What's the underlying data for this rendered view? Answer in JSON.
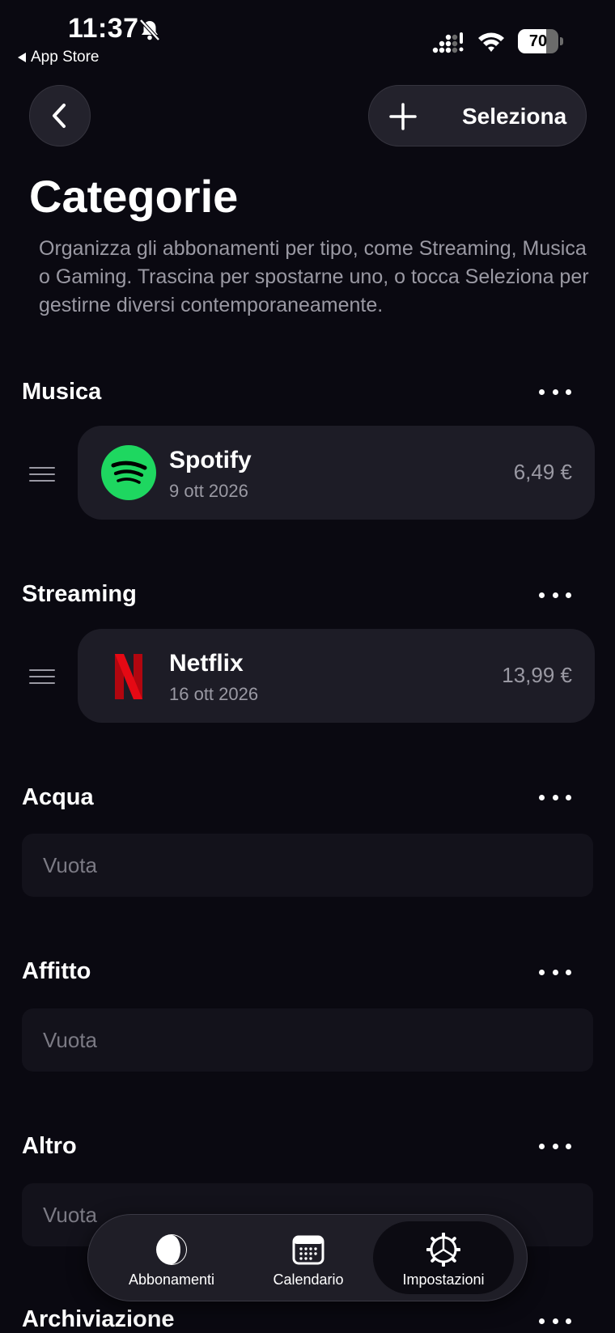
{
  "status_bar": {
    "time": "11:37",
    "back_app": "App Store",
    "battery": "70",
    "battery_level": 0.7
  },
  "header": {
    "select_label": "Seleziona",
    "title": "Categorie",
    "description": "Organizza gli abbonamenti per tipo, come Streaming, Musica o Gaming. Trascina per spostarne uno, o tocca Seleziona per gestirne diversi contemporaneamente."
  },
  "sections": [
    {
      "title": "Musica",
      "items": [
        {
          "name": "Spotify",
          "date": "9 ott 2026",
          "price": "6,49 €",
          "icon": "spotify-logo"
        }
      ]
    },
    {
      "title": "Streaming",
      "items": [
        {
          "name": "Netflix",
          "date": "16 ott 2026",
          "price": "13,99 €",
          "icon": "netflix-logo"
        }
      ]
    },
    {
      "title": "Acqua",
      "empty": "Vuota"
    },
    {
      "title": "Affitto",
      "empty": "Vuota"
    },
    {
      "title": "Altro",
      "empty": "Vuota"
    },
    {
      "title": "Archiviazione"
    }
  ],
  "tabs": [
    {
      "label": "Abbonamenti",
      "icon": "circle-half-icon",
      "active": false
    },
    {
      "label": "Calendario",
      "icon": "calendar-icon",
      "active": false
    },
    {
      "label": "Impostazioni",
      "icon": "gear-icon",
      "active": true
    }
  ],
  "colors": {
    "background": "#0a0911",
    "card": "#1d1c26",
    "spotify": "#1ed760",
    "netflix": "#e50914"
  }
}
